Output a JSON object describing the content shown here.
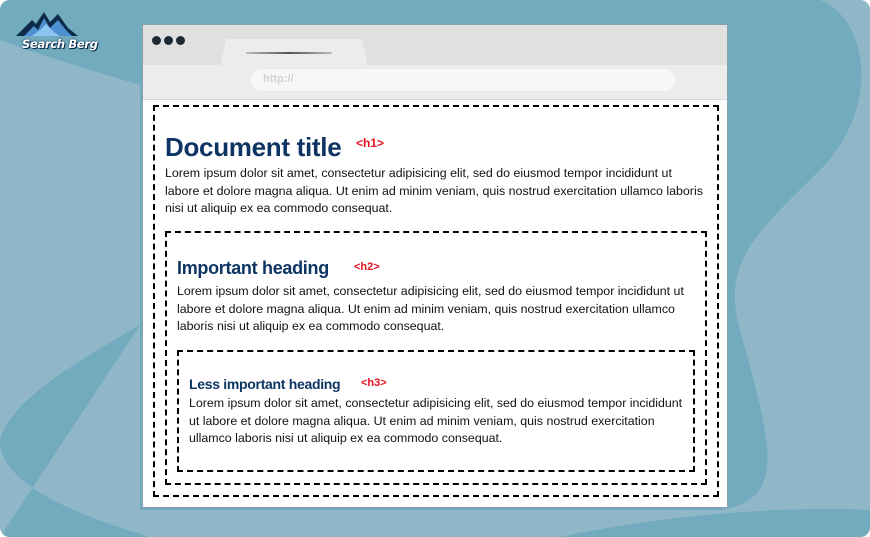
{
  "brand": {
    "logo_text": "Search Berg",
    "colors": {
      "bg_light": "#8fb7c8",
      "bg_dark": "#72aabe",
      "heading": "#0e3463",
      "tag": "#e8101e"
    }
  },
  "browser": {
    "address_placeholder": "http://",
    "window_controls": [
      "dot",
      "dot",
      "dot"
    ]
  },
  "document": {
    "h1": {
      "text": "Document title",
      "tag": "<h1>",
      "body": "Lorem ipsum dolor sit amet, consectetur adipisicing elit, sed do eiusmod tempor incididunt ut labore et dolore magna aliqua. Ut enim ad minim veniam, quis nostrud exercitation ullamco laboris nisi ut aliquip ex ea commodo consequat."
    },
    "h2": {
      "text": "Important heading",
      "tag": "<h2>",
      "body": "Lorem ipsum dolor sit amet, consectetur adipisicing elit, sed do eiusmod tempor incididunt ut labore et dolore magna aliqua. Ut enim ad minim veniam, quis nostrud exercitation ullamco laboris nisi ut aliquip ex ea commodo consequat."
    },
    "h3": {
      "text": "Less important heading",
      "tag": "<h3>",
      "body": "Lorem ipsum dolor sit amet, consectetur adipisicing elit, sed do eiusmod tempor incididunt ut labore et dolore magna aliqua. Ut enim ad minim veniam, quis nostrud exercitation ullamco laboris nisi ut aliquip ex ea commodo consequat."
    }
  }
}
